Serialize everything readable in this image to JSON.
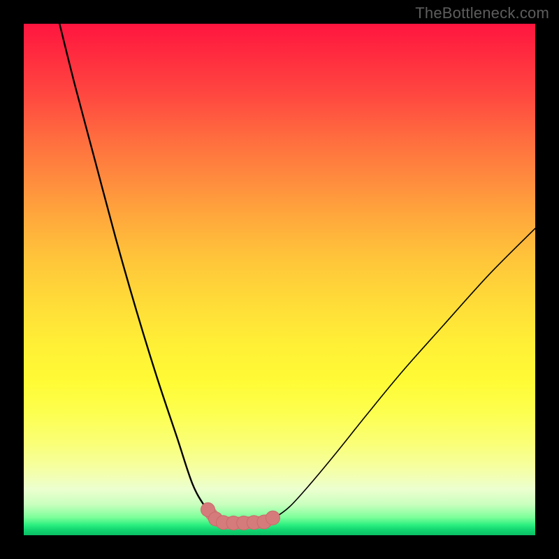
{
  "watermark": "TheBottleneck.com",
  "colors": {
    "frame": "#000000",
    "curve": "#000000",
    "marker_fill": "#d57b7b",
    "marker_stroke": "#c96a6a"
  },
  "chart_data": {
    "type": "line",
    "title": "",
    "xlabel": "",
    "ylabel": "",
    "xlim": [
      0,
      100
    ],
    "ylim": [
      0,
      100
    ],
    "grid": false,
    "legend": false,
    "series": [
      {
        "name": "left-branch",
        "x": [
          7,
          10,
          14,
          18,
          22,
          26,
          30,
          33,
          35.5,
          37.5,
          39
        ],
        "y": [
          100,
          88,
          73,
          58,
          44,
          31,
          19,
          10,
          5.5,
          3.2,
          2.6
        ]
      },
      {
        "name": "right-branch",
        "x": [
          47,
          49,
          52,
          56,
          61,
          67,
          74,
          82,
          91,
          100
        ],
        "y": [
          2.6,
          3.4,
          5.6,
          10,
          16,
          23.5,
          32,
          41,
          51,
          60
        ]
      },
      {
        "name": "basin-markers",
        "x": [
          36.0,
          37.5,
          39.0,
          41.0,
          43.0,
          45.0,
          47.0,
          48.7
        ],
        "y": [
          5.0,
          3.2,
          2.5,
          2.4,
          2.4,
          2.5,
          2.6,
          3.4
        ]
      }
    ],
    "annotations": []
  }
}
